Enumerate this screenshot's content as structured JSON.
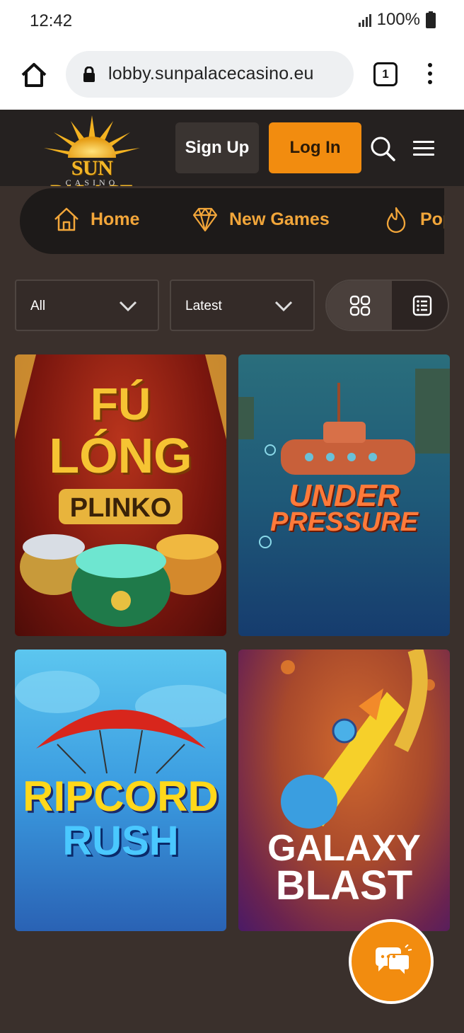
{
  "status_bar": {
    "time": "12:42",
    "battery": "100%"
  },
  "browser": {
    "url": "lobby.sunpalacecasino.eu",
    "tab_count": "1"
  },
  "header": {
    "logo_text": "SUN PALACE",
    "logo_subtext": "CASINO",
    "signup_label": "Sign Up",
    "login_label": "Log In"
  },
  "categories": [
    {
      "label": "Home",
      "icon": "house-icon"
    },
    {
      "label": "New Games",
      "icon": "diamond-icon"
    },
    {
      "label": "Popular",
      "icon": "flame-icon"
    }
  ],
  "filters": {
    "category_value": "All",
    "sort_value": "Latest"
  },
  "games": [
    {
      "title_line1": "FÚ",
      "title_line2": "LÓNG",
      "title_line3": "PLINKO"
    },
    {
      "title_line1": "UNDER",
      "title_line2": "PRESSURE"
    },
    {
      "title_line1": "RIPCORD",
      "title_line2": "RUSH"
    },
    {
      "title_line1": "GALAXY",
      "title_line2": "BLAST"
    }
  ],
  "colors": {
    "accent": "#f28c0f",
    "header_bg": "#252120",
    "page_bg": "#3a302c",
    "nav_text": "#f2a63a"
  }
}
